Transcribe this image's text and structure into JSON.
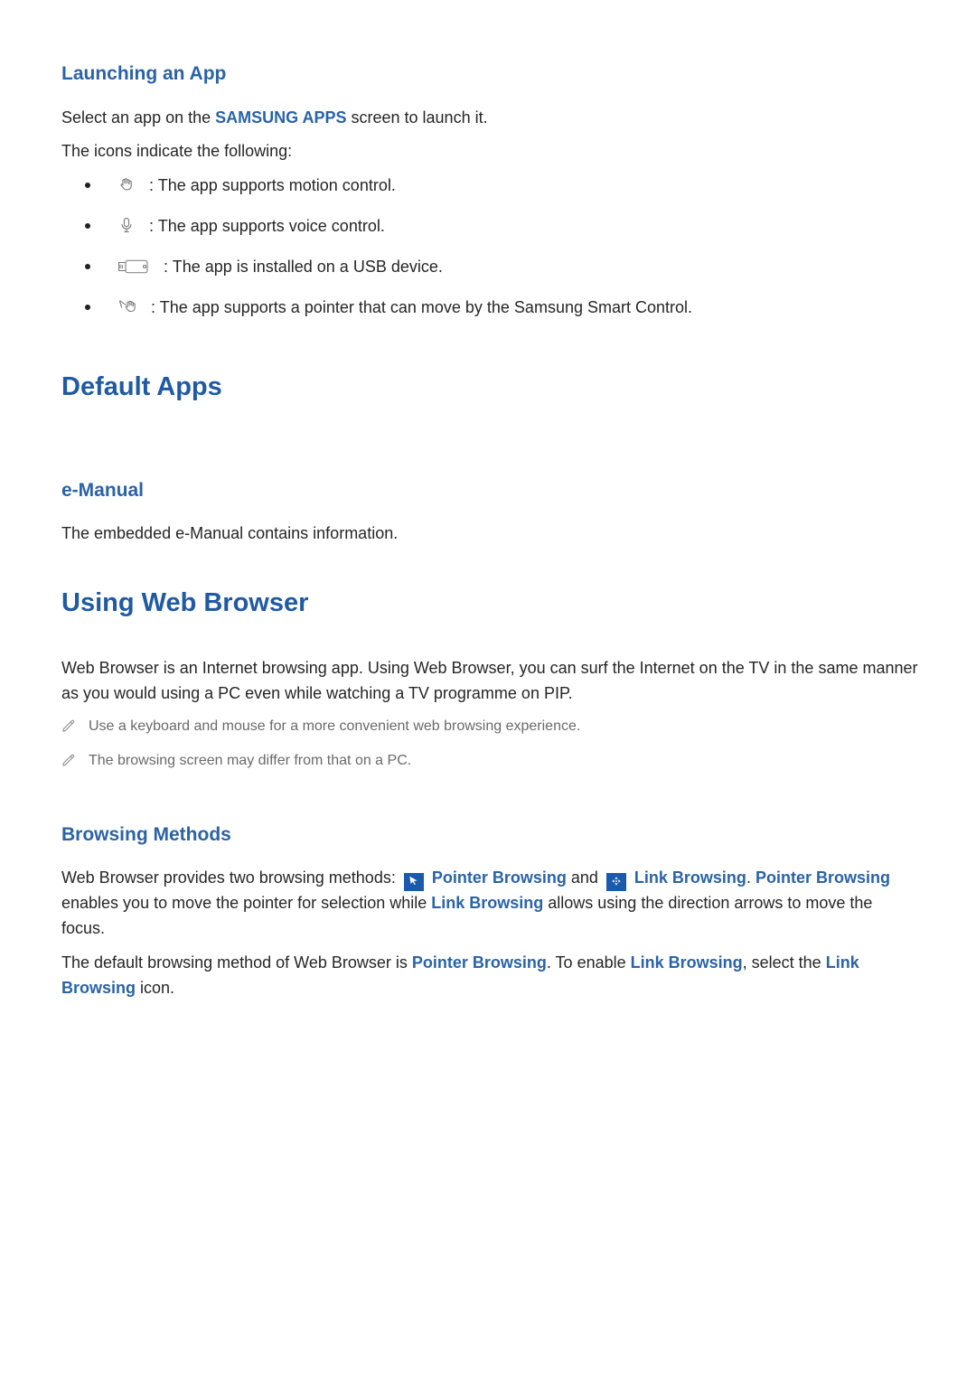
{
  "section_launching": {
    "title": "Launching an App",
    "intro_a": "Select an app on the ",
    "intro_b_bold": "SAMSUNG APPS",
    "intro_c": " screen to launch it.",
    "icons_lead": "The icons indicate the following:",
    "items": [
      ": The app supports motion control.",
      ": The app supports voice control.",
      ": The app is installed on a USB device.",
      ": The app supports a pointer that can move by the Samsung Smart Control."
    ]
  },
  "section_default": {
    "title": "Default Apps"
  },
  "section_emanual": {
    "title": "e-Manual",
    "body": "The embedded e-Manual contains information."
  },
  "section_web": {
    "title": "Using Web Browser",
    "body": "Web Browser is an Internet browsing app. Using Web Browser, you can surf the Internet on the TV in the same manner as you would using a PC even while watching a TV programme on PIP.",
    "notes": [
      "Use a keyboard and mouse for a more convenient web browsing experience.",
      "The browsing screen may differ from that on a PC."
    ]
  },
  "section_methods": {
    "title": "Browsing Methods",
    "p1": {
      "a": "Web Browser provides two browsing methods: ",
      "pb_label": "Pointer Browsing",
      "mid": " and ",
      "lb_label": "Link Browsing",
      "c1": ". ",
      "pb2": "Pointer Browsing",
      "c2": " enables you to move the pointer for selection while ",
      "lb2": "Link Browsing",
      "c3": " allows using the direction arrows to move the focus."
    },
    "p2": {
      "a": "The default browsing method of Web Browser is ",
      "pb": "Pointer Browsing",
      "b": ". To enable ",
      "lb": "Link Browsing",
      "c": ", select the ",
      "lb2": "Link Browsing",
      "d": " icon."
    }
  }
}
